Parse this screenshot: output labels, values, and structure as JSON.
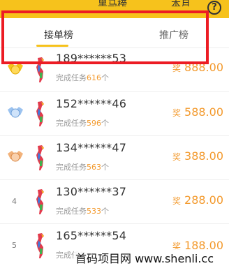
{
  "header": {
    "title": "黑马榜",
    "month": "本月",
    "help_glyph": "?"
  },
  "tabs": [
    {
      "label": "接单榜",
      "active": true
    },
    {
      "label": "推广榜",
      "active": false
    }
  ],
  "list": [
    {
      "rank": "",
      "badge": "gold",
      "phone": "189******53",
      "desc_prefix": "完成任务",
      "count": "616",
      "desc_suffix": "个",
      "reward_label": "奖",
      "reward": "888.00"
    },
    {
      "rank": "",
      "badge": "silver",
      "phone": "152******46",
      "desc_prefix": "完成任务",
      "count": "596",
      "desc_suffix": "个",
      "reward_label": "奖",
      "reward": "588.00"
    },
    {
      "rank": "",
      "badge": "bronze",
      "phone": "134******47",
      "desc_prefix": "完成任务",
      "count": "563",
      "desc_suffix": "个",
      "reward_label": "奖",
      "reward": "388.00"
    },
    {
      "rank": "4",
      "badge": "",
      "phone": "130******37",
      "desc_prefix": "完成任务",
      "count": "533",
      "desc_suffix": "个",
      "reward_label": "奖",
      "reward": "288.00"
    },
    {
      "rank": "5",
      "badge": "",
      "phone": "165******54",
      "desc_prefix": "完成任务",
      "count": "",
      "desc_suffix": "",
      "reward_label": "奖",
      "reward": "188.00"
    }
  ],
  "colors": {
    "accent": "#f6c21c",
    "reward": "#f39a2e",
    "highlight_box": "#ec1c24"
  },
  "watermark": "首码项目网 www.shenli.cc"
}
